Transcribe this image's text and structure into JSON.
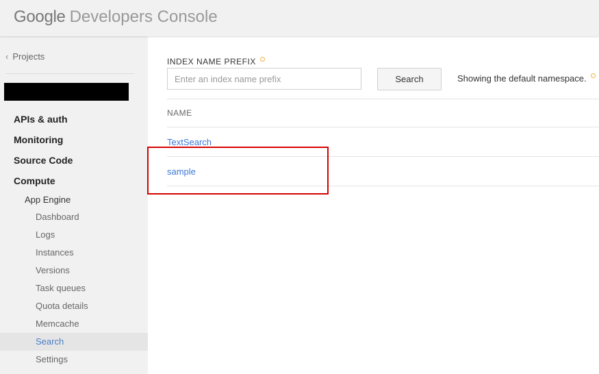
{
  "header": {
    "brand_google": "Google",
    "brand_product": "Developers Console"
  },
  "sidebar": {
    "back_label": "Projects",
    "sections": [
      "APIs & auth",
      "Monitoring",
      "Source Code",
      "Compute"
    ],
    "sub_section": "App Engine",
    "items": [
      {
        "label": "Dashboard"
      },
      {
        "label": "Logs"
      },
      {
        "label": "Instances"
      },
      {
        "label": "Versions"
      },
      {
        "label": "Task queues"
      },
      {
        "label": "Quota details"
      },
      {
        "label": "Memcache"
      },
      {
        "label": "Search"
      },
      {
        "label": "Settings"
      }
    ],
    "active_item": "Search"
  },
  "main": {
    "field_label": "INDEX NAME PREFIX",
    "search_placeholder": "Enter an index name prefix",
    "search_value": "",
    "search_button_label": "Search",
    "namespace_note": "Showing the default namespace.",
    "column_header": "NAME",
    "indexes": [
      "TextSearch",
      "sample"
    ]
  },
  "colors": {
    "accent_link": "#3c78d8",
    "active_nav_text": "#4a7fc8",
    "highlight_border": "#d80000",
    "help_dot": "#f2b447"
  }
}
